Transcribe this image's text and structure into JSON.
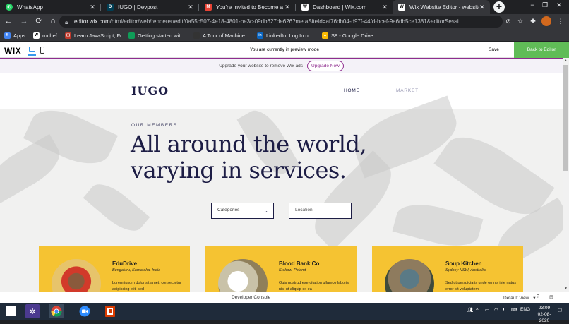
{
  "browser": {
    "tabs": [
      {
        "title": "WhatsApp",
        "favicon": "whatsapp-icon",
        "color": "#25d366",
        "active": false
      },
      {
        "title": "IUGO | Devpost",
        "favicon": "devpost-icon",
        "color": "#003e54",
        "active": false
      },
      {
        "title": "You're Invited to Become a Web…",
        "favicon": "gmail-icon",
        "color": "#ea4335",
        "active": false
      },
      {
        "title": "Dashboard | Wix.com",
        "favicon": "wix-icon",
        "color": "#ffffff",
        "active": false
      },
      {
        "title": "Wix Website Editor - website",
        "favicon": "wix-icon",
        "color": "#ffffff",
        "active": true
      }
    ],
    "new_tab": "+",
    "window_controls": [
      "−",
      "❐",
      "✕"
    ],
    "url_host": "editor.wix.com",
    "url_path": "/html/editor/web/renderer/edit/0a55c507-4e18-4801-be3c-09db627de626?metaSiteId=af76db04-d97f-44fd-bcef-9a6db5ce1381&editorSessi...",
    "bookmarks": [
      {
        "label": "Apps",
        "icon": "apps-grid-icon",
        "color": "#4285f4"
      },
      {
        "label": "rochef",
        "icon": "wix-icon",
        "color": "#ffffff"
      },
      {
        "label": "Learn JavaScript, Fr...",
        "icon": "freecodecamp-icon",
        "color": "#c0392b"
      },
      {
        "label": "Getting started wit...",
        "icon": "bookmark-icon",
        "color": "#0f9d58"
      },
      {
        "label": "A Tour of Machine...",
        "icon": "bookmark-icon",
        "color": "#333333"
      },
      {
        "label": "LinkedIn: Log In or...",
        "icon": "linkedin-icon",
        "color": "#0a66c2"
      },
      {
        "label": "S8 - Google Drive",
        "icon": "google-drive-icon",
        "color": "#fbbc04"
      }
    ]
  },
  "wix_bar": {
    "logo": "WIX",
    "preview_message": "You are currently in preview mode",
    "save_label": "Save",
    "back_label": "Back to Editor"
  },
  "upgrade_banner": {
    "text": "Upgrade your website to remove Wix ads",
    "button": "Upgrade Now"
  },
  "site": {
    "logo": "IUGO",
    "nav": [
      {
        "label": "HOME",
        "color": "#1d1d45"
      },
      {
        "label": "MARKET",
        "color": "#9a9ab5"
      }
    ],
    "eyebrow": "OUR MEMBERS",
    "headline": "All around the world,\nvarying in services.",
    "filters": {
      "category_value": "Categories",
      "location_placeholder": "Location"
    },
    "cards": [
      {
        "name": "EduDrive",
        "location": "Bengaluru, Karnataka, India",
        "desc": "Lorem ipsum dolor sit amet, consectetur adipiscing elit, sed",
        "photo": "child-photo"
      },
      {
        "name": "Blood Bank Co",
        "location": "Krakow, Poland",
        "desc": "Quis nostrud exercitation ullamco laboris nisi ut aliquip ex ea",
        "photo": "lab-photo"
      },
      {
        "name": "Soup Kitchen",
        "location": "Sydney NSW, Australia",
        "desc": "Sed ut perspiciatis unde omnis iste natus error sit voluptatem",
        "photo": "kitchen-photo"
      }
    ]
  },
  "dev_console": {
    "label": "Developer Console",
    "view": "Default View"
  },
  "taskbar": {
    "apps": [
      "windows-start-icon",
      "settings-icon",
      "chrome-icon",
      "zoom-icon",
      "office-icon"
    ],
    "language": "ENG",
    "time": "23:09",
    "date": "02-08-2020"
  }
}
